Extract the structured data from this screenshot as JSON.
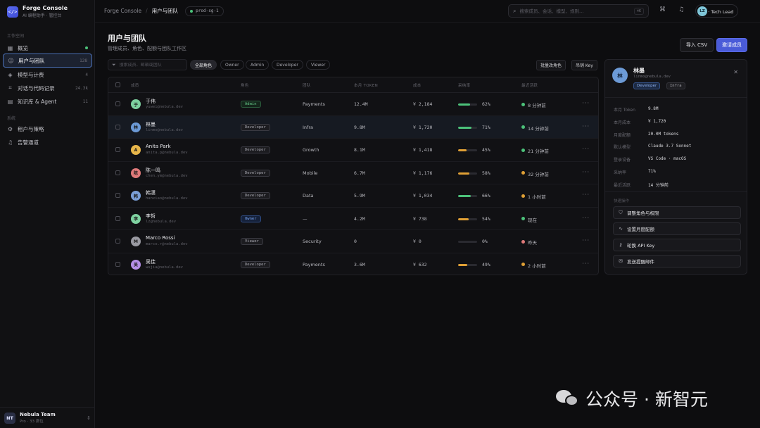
{
  "brand": {
    "name": "Forge Console",
    "subtitle": "AI 编程助手 · 管控台",
    "logo_glyph": "</>"
  },
  "sidebar": {
    "section_workspace": "工作空间",
    "section_system": "系统",
    "items": [
      {
        "label": "概览",
        "icon": "grid-icon",
        "indicator": "dot"
      },
      {
        "label": "用户与团队",
        "icon": "users-icon",
        "count": "128",
        "active": true
      },
      {
        "label": "模型与计费",
        "icon": "cube-icon",
        "count": "4"
      },
      {
        "label": "对话与代码记录",
        "icon": "code-icon",
        "count": "24.3k"
      },
      {
        "label": "知识库 & Agent",
        "icon": "book-icon",
        "count": "11"
      },
      {
        "label": "租户与策略",
        "icon": "gear-icon"
      },
      {
        "label": "告警通道",
        "icon": "bell-icon"
      }
    ],
    "team": {
      "initials": "NT",
      "name": "Nebula Team",
      "plan": "Pro · 33 席位"
    }
  },
  "topbar": {
    "breadcrumb_root": "Forge Console",
    "breadcrumb_sep": "/",
    "breadcrumb_current": "用户与团队",
    "env": "prod-sg-1",
    "search_placeholder": "搜索成员、会话、模型、规则…",
    "search_shortcut": "⌘K",
    "user_initials": "LZ",
    "user_label": "李哲 · Tech Lead"
  },
  "page": {
    "title": "用户与团队",
    "subtitle": "管理成员、角色、配额与团队工作区",
    "import_label": "导入 CSV",
    "invite_label": "邀请成员"
  },
  "filters": {
    "search_placeholder": "搜索成员、邮箱或团队",
    "chips": [
      "全部角色",
      "Owner",
      "Admin",
      "Developer",
      "Viewer"
    ],
    "bulk_role": "批量改角色",
    "revoke_key": "吊销 Key"
  },
  "table": {
    "headers": [
      "成员",
      "角色",
      "团队",
      "本月 TOKEN",
      "成本",
      "采纳率",
      "最近活跃"
    ],
    "rows": [
      {
        "initial": "于",
        "avatar": "#7ed1a0",
        "name": "于伟",
        "email": "yuwei@nebula.dev",
        "role": "Admin",
        "role_kind": "admin",
        "team": "Payments",
        "tokens": "12.4M",
        "cost": "¥ 2,184",
        "rate": 62,
        "rate_label": "62%",
        "bar": "#4cc27a",
        "active": "8 分钟前",
        "dot": "#4cc27a"
      },
      {
        "initial": "林",
        "avatar": "#6c9ad6",
        "name": "林墨",
        "email": "linmo@nebula.dev",
        "role": "Developer",
        "role_kind": "dev",
        "team": "Infra",
        "tokens": "9.8M",
        "cost": "¥ 1,720",
        "rate": 71,
        "rate_label": "71%",
        "bar": "#4cc27a",
        "active": "14 分钟前",
        "dot": "#4cc27a",
        "selected": true
      },
      {
        "initial": "A",
        "avatar": "#e8b64a",
        "name": "Anita Park",
        "email": "anita.p@nebula.dev",
        "role": "Developer",
        "role_kind": "dev",
        "team": "Growth",
        "tokens": "8.1M",
        "cost": "¥ 1,418",
        "rate": 45,
        "rate_label": "45%",
        "bar": "#e0a035",
        "active": "21 分钟前",
        "dot": "#4cc27a"
      },
      {
        "initial": "陈",
        "avatar": "#e07a7a",
        "name": "陈一鸣",
        "email": "chen.ym@nebula.dev",
        "role": "Developer",
        "role_kind": "dev",
        "team": "Mobile",
        "tokens": "6.7M",
        "cost": "¥ 1,176",
        "rate": 58,
        "rate_label": "58%",
        "bar": "#e0a035",
        "active": "32 分钟前",
        "dot": "#e0a035"
      },
      {
        "initial": "韩",
        "avatar": "#7a9ed6",
        "name": "韩潇",
        "email": "hanxiao@nebula.dev",
        "role": "Developer",
        "role_kind": "dev",
        "team": "Data",
        "tokens": "5.9M",
        "cost": "¥ 1,034",
        "rate": 66,
        "rate_label": "66%",
        "bar": "#4cc27a",
        "active": "1 小时前",
        "dot": "#e0a035"
      },
      {
        "initial": "李",
        "avatar": "#7ed1a0",
        "name": "李哲",
        "email": "lz@nebula.dev",
        "role": "Owner",
        "role_kind": "owner",
        "team": "—",
        "tokens": "4.2M",
        "cost": "¥ 738",
        "rate": 54,
        "rate_label": "54%",
        "bar": "#e0a035",
        "active": "现在",
        "dot": "#4cc27a"
      },
      {
        "initial": "M",
        "avatar": "#9a9aa2",
        "name": "Marco Rossi",
        "email": "marco.r@nebula.dev",
        "role": "Viewer",
        "role_kind": "dev",
        "team": "Security",
        "tokens": "0",
        "cost": "¥ 0",
        "rate": 0,
        "rate_label": "0%",
        "bar": "#4cc27a",
        "active": "昨天",
        "dot": "#e07a7a"
      },
      {
        "initial": "吴",
        "avatar": "#b58ee8",
        "name": "吴佳",
        "email": "wujia@nebula.dev",
        "role": "Developer",
        "role_kind": "dev",
        "team": "Payments",
        "tokens": "3.6M",
        "cost": "¥ 632",
        "rate": 49,
        "rate_label": "49%",
        "bar": "#e0a035",
        "active": "2 小时前",
        "dot": "#e0a035"
      }
    ]
  },
  "panel": {
    "initial": "林",
    "name": "林墨",
    "email": "linmo@nebula.dev",
    "tags": [
      "Developer",
      "Infra"
    ],
    "fields": [
      {
        "k": "本月 Token",
        "v": "9.8M"
      },
      {
        "k": "本月成本",
        "v": "¥ 1,720"
      },
      {
        "k": "月度配额",
        "v": "20.0M tokens"
      },
      {
        "k": "默认模型",
        "v": "Claude 3.7 Sonnet"
      },
      {
        "k": "登录设备",
        "v": "VS Code · macOS"
      },
      {
        "k": "采纳率",
        "v": "71%"
      },
      {
        "k": "最近活跃",
        "v": "14 分钟前"
      }
    ],
    "section": "快速操作",
    "actions": [
      {
        "label": "调整角色与权限",
        "icon": "shield-icon"
      },
      {
        "label": "设置月度配额",
        "icon": "pulse-icon"
      },
      {
        "label": "轮换 API Key",
        "icon": "key-icon"
      },
      {
        "label": "发送提醒邮件",
        "icon": "mail-icon"
      }
    ]
  },
  "watermark": {
    "text": "公众号 · 新智元"
  }
}
